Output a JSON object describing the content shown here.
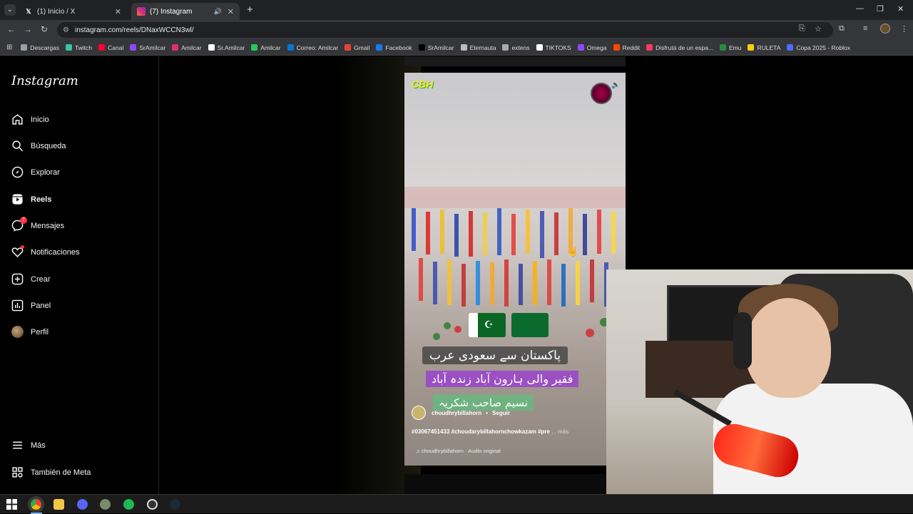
{
  "browser": {
    "tabs": [
      {
        "title": "(1) Inicio / X",
        "icon": "x-logo-icon"
      },
      {
        "title": "(7) Instagram",
        "icon": "instagram-icon",
        "active": true
      }
    ],
    "url": "instagram.com/reels/DNaxWCCN3wl/",
    "bookmarks": [
      {
        "label": "Descargas",
        "color": "#9aa0a6"
      },
      {
        "label": "Twitch",
        "color": "#36c5a8"
      },
      {
        "label": "Canal",
        "color": "#ff0033"
      },
      {
        "label": "SrAmilcar",
        "color": "#9146ff"
      },
      {
        "label": "Amilcar",
        "color": "#e1306c"
      },
      {
        "label": "Sr.Amilcar",
        "color": "#ffffff"
      },
      {
        "label": "Amilcar",
        "color": "#22cc55"
      },
      {
        "label": "Correo: Amilcar",
        "color": "#0078d4"
      },
      {
        "label": "Gmail",
        "color": "#ea4335"
      },
      {
        "label": "Facebook",
        "color": "#1877f2"
      },
      {
        "label": "SrAmilcar",
        "color": "#000000"
      },
      {
        "label": "Eternauta",
        "color": "#bbbbbb"
      },
      {
        "label": "extens",
        "color": "#aaaaaa"
      },
      {
        "label": "TIKTOKS",
        "color": "#ffffff"
      },
      {
        "label": "Omega",
        "color": "#9146ff"
      },
      {
        "label": "Reddit",
        "color": "#ff4500"
      },
      {
        "label": "Disfrutá de un espa...",
        "color": "#ff385c"
      },
      {
        "label": "Emu",
        "color": "#2b8a3e"
      },
      {
        "label": "RULETA",
        "color": "#ffcc00"
      },
      {
        "label": "Copa 2025 - Roblox",
        "color": "#4b6cff"
      }
    ]
  },
  "sidebar": {
    "logo": "Instagram",
    "items": [
      {
        "label": "Inicio",
        "icon": "home-icon"
      },
      {
        "label": "Búsqueda",
        "icon": "search-icon"
      },
      {
        "label": "Explorar",
        "icon": "compass-icon"
      },
      {
        "label": "Reels",
        "icon": "reels-icon",
        "active": true
      },
      {
        "label": "Mensajes",
        "icon": "messenger-icon",
        "badge": "7"
      },
      {
        "label": "Notificaciones",
        "icon": "heart-icon",
        "dot": true
      },
      {
        "label": "Crear",
        "icon": "plus-square-icon"
      },
      {
        "label": "Panel",
        "icon": "chart-icon"
      },
      {
        "label": "Perfil",
        "icon": "avatar"
      }
    ],
    "footer": [
      {
        "label": "Más",
        "icon": "menu-icon"
      },
      {
        "label": "También de Meta",
        "icon": "meta-icon"
      }
    ]
  },
  "reel": {
    "watermark": "CBH",
    "overlay_line1": "پاکستان سے سعودی عرب",
    "overlay_line2": "فقیر والی ہارون آباد زندہ آباد",
    "overlay_line3": "نسیم صاحب شکریہ",
    "owner": "choudhrybillahorn",
    "separator": "•",
    "follow_label": "Seguir",
    "caption": "#03067451433 #choudarybillahornchowkazam #pre",
    "caption_more": "... más",
    "audio": "choudhrybillahorn · Audio original"
  },
  "colors": {
    "accent": "#ff3040",
    "sidebar_bg": "#000000"
  }
}
